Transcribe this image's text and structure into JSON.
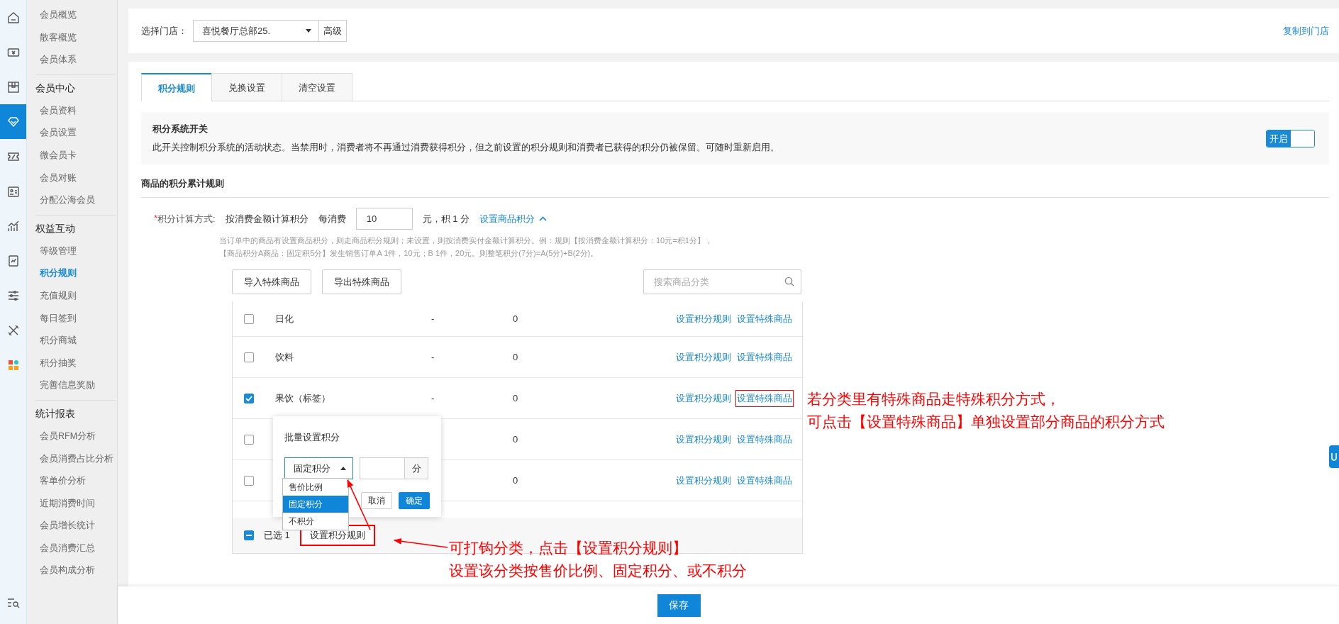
{
  "nav_icons": [
    {
      "kind": "home",
      "selected": false
    },
    {
      "kind": "money",
      "selected": false
    },
    {
      "kind": "box",
      "selected": false
    },
    {
      "kind": "diamond",
      "selected": true
    },
    {
      "kind": "ticket",
      "selected": false
    },
    {
      "kind": "card",
      "selected": false
    },
    {
      "kind": "chart",
      "selected": false
    },
    {
      "kind": "report",
      "selected": false
    },
    {
      "kind": "sliders",
      "selected": false
    },
    {
      "kind": "tools",
      "selected": false
    },
    {
      "kind": "apps",
      "selected": false
    }
  ],
  "sidebar": {
    "groups": [
      {
        "items": [
          {
            "label": "会员概览",
            "selected": false
          },
          {
            "label": "散客概览",
            "selected": false
          },
          {
            "label": "会员体系",
            "selected": false
          }
        ]
      },
      {
        "title": "会员中心",
        "items": [
          {
            "label": "会员资料",
            "selected": false
          },
          {
            "label": "会员设置",
            "selected": false
          },
          {
            "label": "微会员卡",
            "selected": false
          },
          {
            "label": "会员对账",
            "selected": false
          },
          {
            "label": "分配公海会员",
            "selected": false
          }
        ]
      },
      {
        "title": "权益互动",
        "items": [
          {
            "label": "等级管理",
            "selected": false
          },
          {
            "label": "积分规则",
            "selected": true
          },
          {
            "label": "充值规则",
            "selected": false
          },
          {
            "label": "每日签到",
            "selected": false
          },
          {
            "label": "积分商城",
            "selected": false
          },
          {
            "label": "积分抽奖",
            "selected": false
          },
          {
            "label": "完善信息奖励",
            "selected": false
          }
        ]
      },
      {
        "title": "统计报表",
        "items": [
          {
            "label": "会员RFM分析",
            "selected": false
          },
          {
            "label": "会员消费占比分析",
            "selected": false
          },
          {
            "label": "客单价分析",
            "selected": false
          },
          {
            "label": "近期消费时间",
            "selected": false
          },
          {
            "label": "会员增长统计",
            "selected": false
          },
          {
            "label": "会员消费汇总",
            "selected": false
          },
          {
            "label": "会员构成分析",
            "selected": false
          }
        ]
      }
    ]
  },
  "store": {
    "label": "选择门店：",
    "value": "喜悦餐厅总部25.",
    "advanced": "高级",
    "copy_link": "复制到门店"
  },
  "tabs": [
    {
      "label": "积分规则",
      "selected": true
    },
    {
      "label": "兑换设置",
      "selected": false
    },
    {
      "label": "清空设置",
      "selected": false
    }
  ],
  "switch_section": {
    "title": "积分系统开关",
    "description": "此开关控制积分系统的活动状态。当禁用时，消费者将不再通过消费获得积分，但之前设置的积分规则和消费者已获得的积分仍被保留。可随时重新启用。",
    "toggle": {
      "label": "开启",
      "on": true
    }
  },
  "rules_heading": "商品的积分累计规则",
  "calc": {
    "required_mark": "*",
    "label": "积分计算方式:",
    "method": "按消费金额计算积分",
    "prefix": "每消费",
    "amount": "10",
    "suffix": "元，积 1 分",
    "link": "设置商品积分",
    "expanded": true,
    "hints": [
      "当订单中的商品有设置商品积分，则走商品积分规则；未设置，则按消费实付金额计算积分。例：规则【按消费金额计算积分：10元=积1分】，",
      "【商品积分A商品：固定积5分】发生销售订单A 1件，10元；B 1件，20元。则整笔积分(7分)=A(5分)+B(2分)。"
    ]
  },
  "toolbar": {
    "import": "导入特殊商品",
    "export": "导出特殊商品",
    "search_placeholder": "搜索商品分类"
  },
  "table": {
    "rows": [
      {
        "checked": false,
        "name": "日化",
        "column_3": "-",
        "column_4": "0",
        "actions": [
          {
            "label": "设置积分规则",
            "highlighted": false
          },
          {
            "label": "设置特殊商品",
            "highlighted": false
          }
        ]
      },
      {
        "checked": false,
        "name": "饮料",
        "column_3": "-",
        "column_4": "0",
        "actions": [
          {
            "label": "设置积分规则",
            "highlighted": false
          },
          {
            "label": "设置特殊商品",
            "highlighted": false
          }
        ]
      },
      {
        "checked": true,
        "name": "果饮（标签）",
        "column_3": "-",
        "column_4": "0",
        "actions": [
          {
            "label": "设置积分规则",
            "highlighted": false
          },
          {
            "label": "设置特殊商品",
            "highlighted": true
          }
        ]
      },
      {
        "checked": false,
        "column_4": "0",
        "actions": [
          {
            "label": "设置积分规则",
            "highlighted": false
          },
          {
            "label": "设置特殊商品",
            "highlighted": false
          }
        ]
      },
      {
        "checked": false,
        "column_4": "0",
        "actions": [
          {
            "label": "设置积分规则",
            "highlighted": false
          },
          {
            "label": "设置特殊商品",
            "highlighted": false
          }
        ]
      }
    ]
  },
  "bulk_bar": {
    "indeterminate": true,
    "selected_text": "已选 1",
    "button": "设置积分规则",
    "highlighted": true
  },
  "popup": {
    "title": "批量设置积分",
    "select_value": "固定积分",
    "open": true,
    "unit": "分",
    "cancel": "取消",
    "confirm": "确定",
    "options": [
      {
        "label": "售价比例",
        "selected": false
      },
      {
        "label": "固定积分",
        "selected": true
      },
      {
        "label": "不积分",
        "selected": false
      }
    ]
  },
  "annotations": [
    {
      "kind": "right",
      "lines": [
        "若分类里有特殊商品走特殊积分方式，",
        "可点击【设置特殊商品】单独设置部分商品的积分方式"
      ]
    },
    {
      "kind": "bottom",
      "lines": [
        "可打钩分类，点击【设置积分规则】",
        "设置该分类按售价比例、固定积分、或不积分"
      ]
    }
  ],
  "save": "保存"
}
